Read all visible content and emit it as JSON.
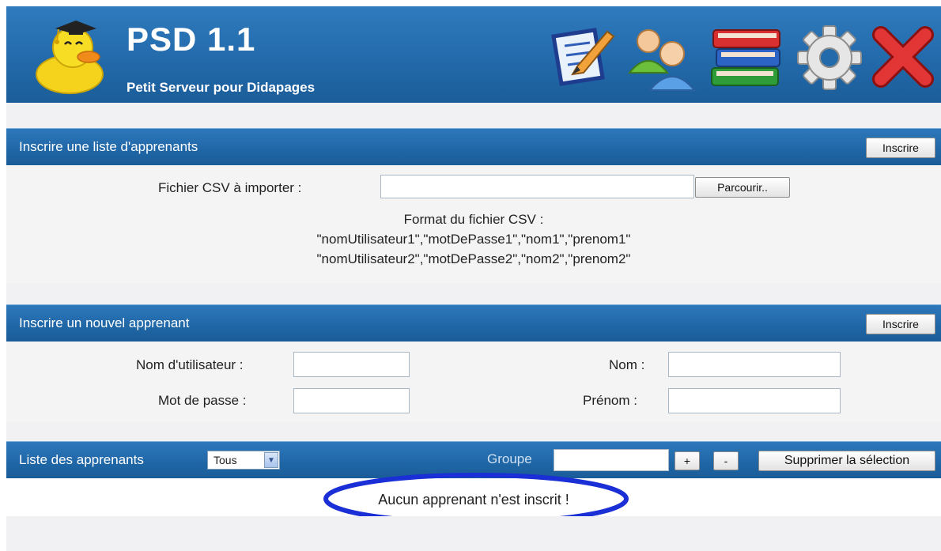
{
  "header": {
    "title": "PSD 1.1",
    "subtitle": "Petit Serveur pour Didapages",
    "logo_icon": "duck-graduate-icon",
    "toolbar_icons": [
      "edit-icon",
      "users-icon",
      "books-icon",
      "gear-icon",
      "close-icon"
    ]
  },
  "import_section": {
    "title": "Inscrire une liste d'apprenants",
    "submit_label": "Inscrire",
    "file_label": "Fichier CSV à importer :",
    "file_value": "",
    "browse_label": "Parcourir..",
    "format_title": "Format du fichier CSV :",
    "format_line1": "\"nomUtilisateur1\",\"motDePasse1\",\"nom1\",\"prenom1\"",
    "format_line2": "\"nomUtilisateur2\",\"motDePasse2\",\"nom2\",\"prenom2\""
  },
  "new_learner_section": {
    "title": "Inscrire un nouvel apprenant",
    "submit_label": "Inscrire",
    "username_label": "Nom d'utilisateur :",
    "username_value": "",
    "password_label": "Mot de passe :",
    "password_value": "",
    "lastname_label": "Nom :",
    "lastname_value": "",
    "firstname_label": "Prénom :",
    "firstname_value": ""
  },
  "list_section": {
    "title": "Liste des apprenants",
    "filter_value": "Tous",
    "group_label": "Groupe",
    "group_value": "",
    "add_label": "+",
    "remove_label": "-",
    "delete_label": "Supprimer la sélection",
    "empty_message": "Aucun apprenant n'est inscrit !"
  },
  "colors": {
    "header_blue": "#236aab",
    "highlight_ellipse": "#1a2fd6",
    "panel_bg": "#f4f4f4"
  }
}
